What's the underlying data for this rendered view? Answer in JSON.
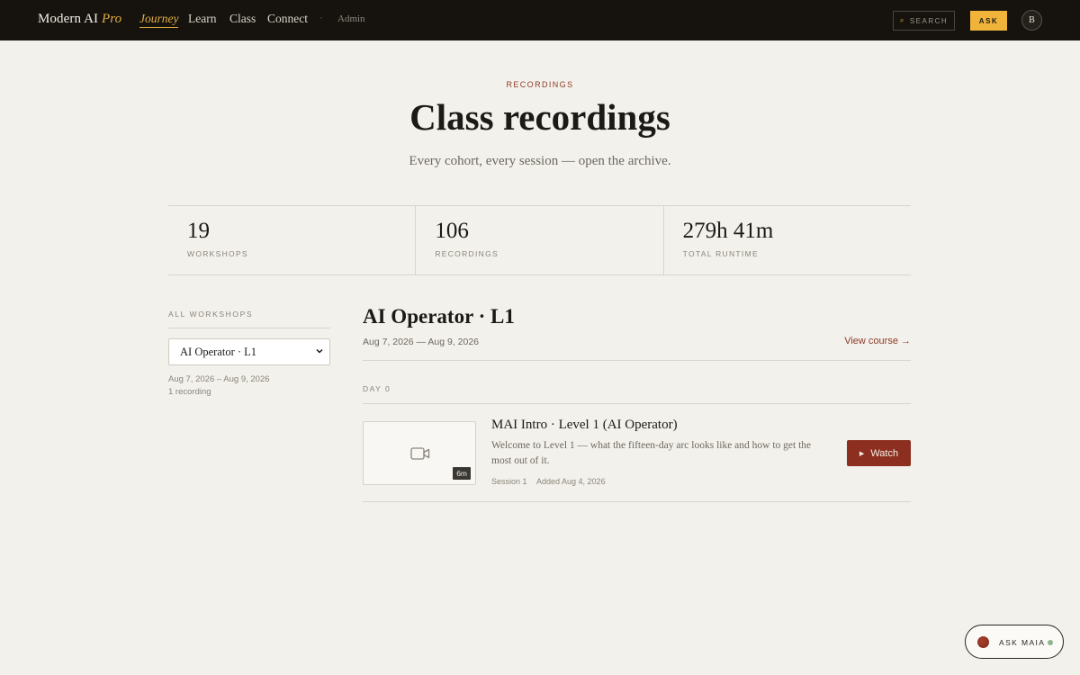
{
  "nav": {
    "brand": "Modern AI",
    "brand_suffix": "Pro",
    "items": [
      {
        "label": "Journey",
        "active": true
      },
      {
        "label": "Learn",
        "active": false
      },
      {
        "label": "Class",
        "active": false
      },
      {
        "label": "Connect",
        "active": false
      }
    ],
    "separator": "·",
    "admin": "Admin",
    "search_label": "SEARCH",
    "search_icon": "search-icon",
    "ask_label": "ASK",
    "avatar_initial": "B"
  },
  "hero": {
    "eyebrow": "RECORDINGS",
    "title": "Class recordings",
    "subtitle": "Every cohort, every session — open the archive."
  },
  "stats": [
    {
      "value": "19",
      "label": "WORKSHOPS"
    },
    {
      "value": "106",
      "label": "RECORDINGS"
    },
    {
      "value": "279h 41m",
      "label": "TOTAL RUNTIME"
    }
  ],
  "sidebar": {
    "label": "ALL WORKSHOPS",
    "selected": "AI Operator · L1",
    "dates": "Aug 7, 2026 – Aug 9, 2026",
    "count": "1 recording"
  },
  "course": {
    "title": "AI Operator · L1",
    "dates": "Aug 7, 2026 — Aug 9, 2026",
    "view_link": "View course →",
    "day_label": "DAY 0"
  },
  "recording": {
    "title": "MAI Intro · Level 1 (AI Operator)",
    "description": "Welcome to Level 1 — what the fifteen-day arc looks like and how to get the most out of it.",
    "session": "Session 1",
    "added": "Added Aug 4, 2026",
    "duration": "6m",
    "watch_label": "Watch",
    "thumb_icon": "video-camera-icon"
  },
  "maia": {
    "label": "ASK MAIA"
  },
  "colors": {
    "nav_bg": "#16130f",
    "accent_gold": "#e2ad3f",
    "accent_red": "#8c2f20",
    "page_bg": "#f3f1ec"
  }
}
